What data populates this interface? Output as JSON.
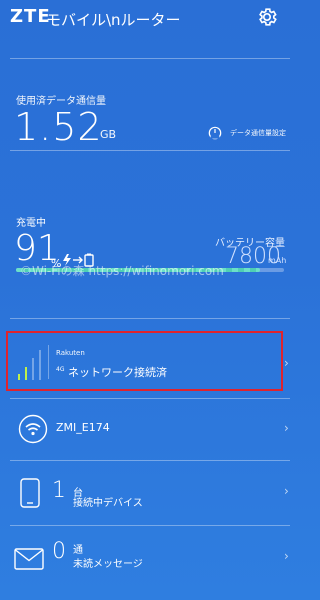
{
  "header": {
    "logo": "ZTE",
    "title": "モバイル\\nルーター"
  },
  "usage": {
    "label": "使用済データ通信量",
    "value": "1.52",
    "unit": "GB",
    "settings_label": "データ通信量設定"
  },
  "battery": {
    "label": "充電中",
    "percent": "91",
    "percent_unit": "%",
    "capacity_label": "バッテリー容量",
    "capacity_value": "7800",
    "capacity_unit": "mAh",
    "level": 0.91,
    "fill_color": "#5fd9c2"
  },
  "watermark": "©Wi-Fiの森  https://wifinomori.com",
  "network": {
    "carrier": "Rakuten",
    "type": "4G",
    "status": "ネットワーク接続済",
    "highlight_color": "#e0232d"
  },
  "wifi": {
    "ssid": "ZMI_E174"
  },
  "devices": {
    "count": "1",
    "unit": "台",
    "label": "接続中デバイス"
  },
  "messages": {
    "count": "0",
    "unit": "通",
    "label": "未読メッセージ"
  },
  "icons": [
    "gear-icon",
    "gauge-icon",
    "charge-icon",
    "signal-icon",
    "wifi-icon",
    "phone-icon",
    "mail-icon",
    "chevron-right-icon"
  ],
  "chevron": "›"
}
